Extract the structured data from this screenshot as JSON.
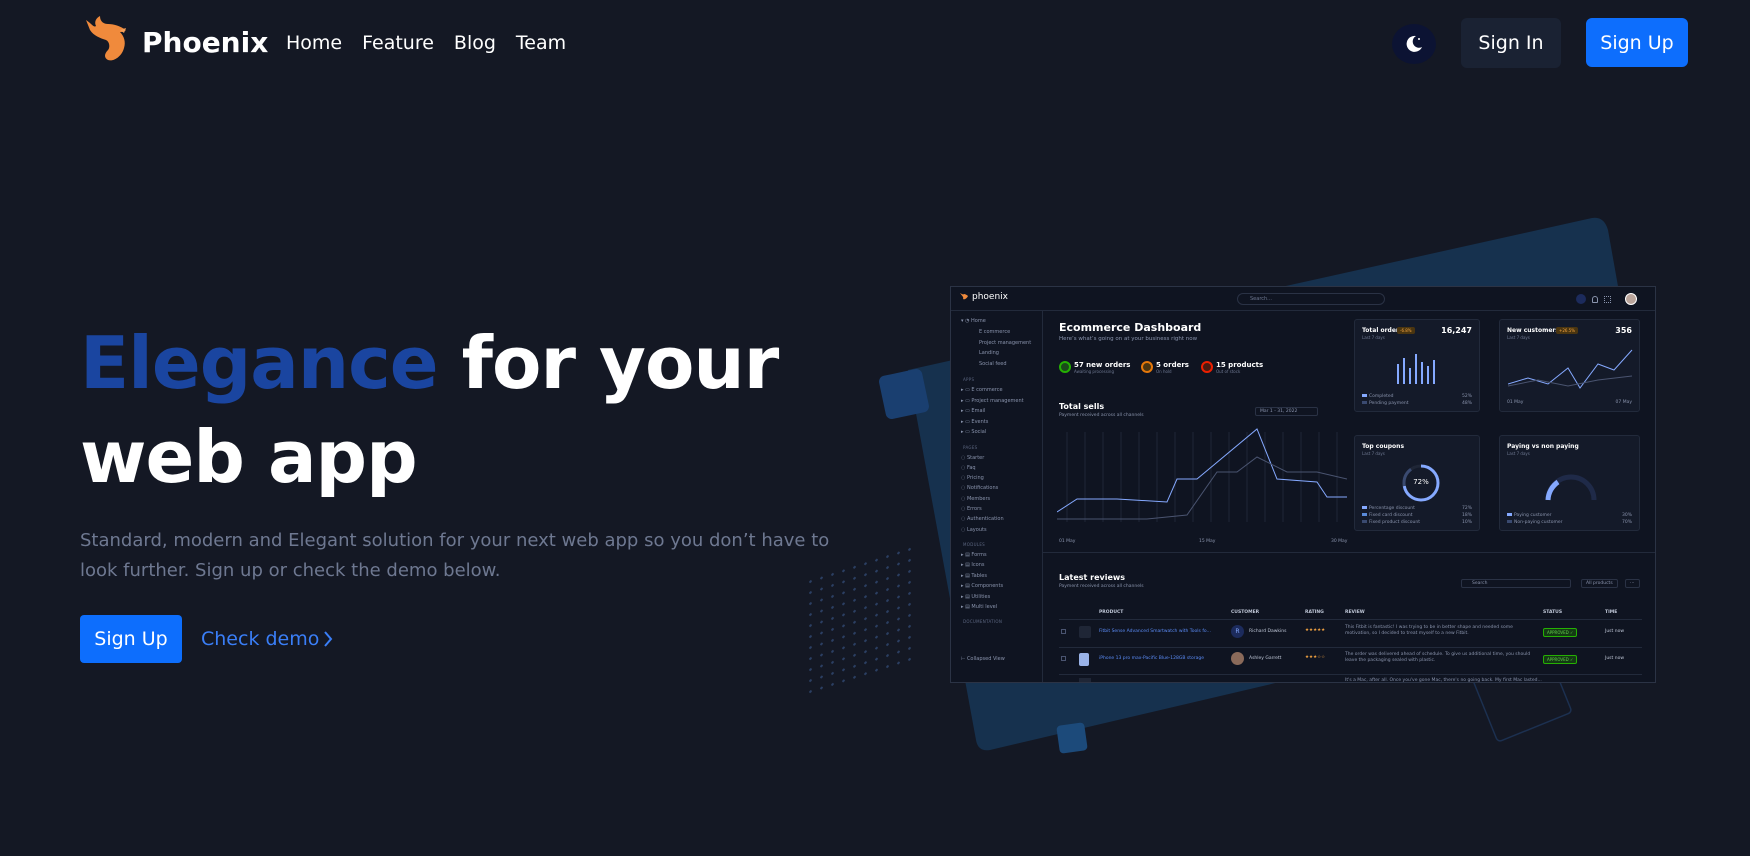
{
  "brand": {
    "name": "Phoenix"
  },
  "nav": {
    "links": [
      "Home",
      "Feature",
      "Blog",
      "Team"
    ],
    "theme_icon": "moon-icon",
    "signin_label": "Sign In",
    "signup_label": "Sign Up"
  },
  "hero": {
    "title_accent": "Elegance",
    "title_rest_line1": "for your",
    "title_line2": "web app",
    "subtitle": "Standard, modern and Elegant solution for your next web app so you don’t have to look further. Sign up or check the demo below.",
    "signup_label": "Sign Up",
    "demo_label": "Check demo"
  },
  "colors": {
    "background": "#141824",
    "accent_blue": "#0d6efd",
    "title_accent": "#1a45a0",
    "brand_orange": "#f08a3c"
  },
  "dashboard": {
    "logo": "phoenix",
    "search_placeholder": "Search...",
    "sidebar": {
      "home": "Home",
      "home_items": [
        "E commerce",
        "Project management",
        "Landing",
        "Social feed"
      ],
      "apps_label": "APPS",
      "apps": [
        "E commerce",
        "Project management",
        "Email",
        "Events",
        "Social"
      ],
      "pages_label": "PAGES",
      "pages": [
        "Starter",
        "Faq",
        "Pricing",
        "Notifications",
        "Members",
        "Errors",
        "Authentication",
        "Layouts"
      ],
      "modules_label": "MODULES",
      "modules": [
        "Forms",
        "Icons",
        "Tables",
        "Components",
        "Utilities",
        "Multi level"
      ],
      "docs_label": "DOCUMENTATION",
      "collapse": "Collapsed View"
    },
    "title": "Ecommerce Dashboard",
    "subtitle": "Here’s what’s going on at your business right now",
    "kpis": [
      {
        "value": "57 new orders",
        "note": "Awaiting processing",
        "color": "#25b003"
      },
      {
        "value": "5 orders",
        "note": "On hold",
        "color": "#e5780b"
      },
      {
        "value": "15 products",
        "note": "Out of stock",
        "color": "#ec1f00"
      }
    ],
    "total_sells": {
      "title": "Total sells",
      "subtitle": "Payment received across all channels",
      "date_range": "Mar 1 - 31, 2022",
      "x_labels": [
        "01 May",
        "15 May",
        "30 May"
      ]
    },
    "total_orders": {
      "title": "Total orders",
      "badge": "-6.8%",
      "value": "16,247",
      "period": "Last 7 days",
      "legend": [
        {
          "label": "Completed",
          "pct": "52%"
        },
        {
          "label": "Pending payment",
          "pct": "48%"
        }
      ]
    },
    "new_customers": {
      "title": "New customers",
      "badge": "+26.5%",
      "value": "356",
      "period": "Last 7 days",
      "x_labels": [
        "01 May",
        "07 May"
      ]
    },
    "top_coupons": {
      "title": "Top coupons",
      "period": "Last 7 days",
      "center": "72%",
      "legend": [
        {
          "label": "Percentage discount",
          "pct": "72%"
        },
        {
          "label": "Fixed card discount",
          "pct": "18%"
        },
        {
          "label": "Fixed product discount",
          "pct": "10%"
        }
      ]
    },
    "paying": {
      "title": "Paying vs non paying",
      "period": "Last 7 days",
      "legend": [
        {
          "label": "Paying customer",
          "pct": "30%"
        },
        {
          "label": "Non-paying customer",
          "pct": "70%"
        }
      ]
    },
    "reviews": {
      "title": "Latest reviews",
      "subtitle": "Payment received across all channels",
      "search_placeholder": "Search",
      "filter": "All products",
      "columns": [
        "PRODUCT",
        "CUSTOMER",
        "RATING",
        "REVIEW",
        "STATUS",
        "TIME"
      ],
      "rows": [
        {
          "product": "Fitbit Sense Advanced Smartwatch with Tools fo...",
          "initial": "R",
          "customer": "Richard Dawkins",
          "review": "This Fitbit is fantastic! I was trying to be in better shape and needed some motivation, so I decided to treat myself to a new Fitbit.",
          "status": "APPROVED ✓",
          "time": "Just now"
        },
        {
          "product": "iPhone 13 pro max-Pacific Blue-128GB storage",
          "initial": "",
          "customer": "Ashley Garrett",
          "review": "The order was delivered ahead of schedule. To give us additional time, you should leave the packaging sealed with plastic.",
          "status": "APPROVED ✓",
          "time": "Just now"
        },
        {
          "product": "",
          "initial": "",
          "customer": "",
          "review": "It's a Mac, after all. Once you've gone Mac, there's no going back. My first Mac lasted...",
          "status": "",
          "time": ""
        }
      ]
    }
  }
}
